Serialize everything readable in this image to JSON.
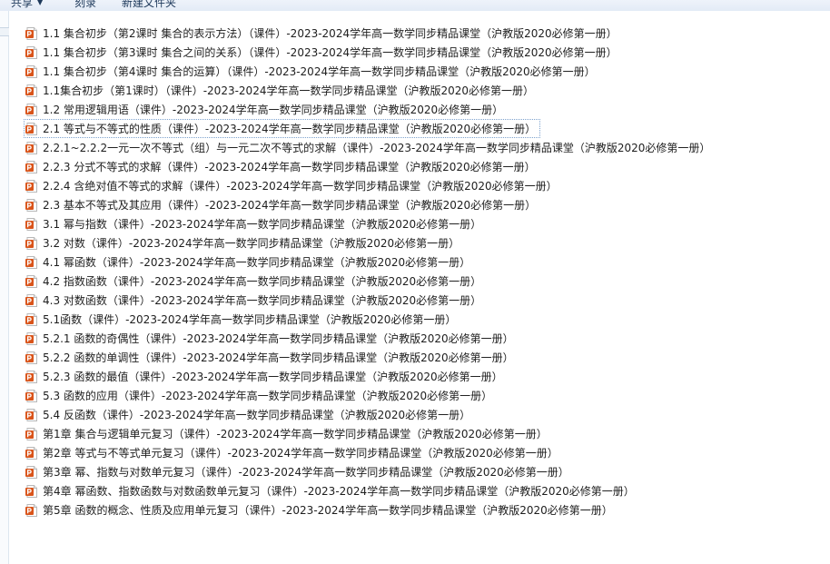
{
  "toolbar": {
    "share_label": "共享",
    "burn_label": "刻录",
    "new_folder_label": "新建文件夹"
  },
  "colors": {
    "icon_orange": "#d9541a",
    "toolbar_bg": "#e3ebf6",
    "focus_border": "#7da2ce"
  },
  "files": [
    {
      "icon": "ppt-file-icon",
      "name": "1.1 集合初步（第2课时 集合的表示方法）（课件）-2023-2024学年高一数学同步精品课堂（沪教版2020必修第一册）"
    },
    {
      "icon": "ppt-file-icon",
      "name": "1.1 集合初步（第3课时 集合之间的关系）（课件）-2023-2024学年高一数学同步精品课堂（沪教版2020必修第一册）"
    },
    {
      "icon": "ppt-file-icon",
      "name": "1.1 集合初步（第4课时 集合的运算）（课件）-2023-2024学年高一数学同步精品课堂（沪教版2020必修第一册）"
    },
    {
      "icon": "ppt-file-icon",
      "name": "1.1集合初步（第1课时）（课件）-2023-2024学年高一数学同步精品课堂（沪教版2020必修第一册）"
    },
    {
      "icon": "ppt-file-icon",
      "name": "1.2 常用逻辑用语（课件）-2023-2024学年高一数学同步精品课堂（沪教版2020必修第一册）"
    },
    {
      "icon": "ppt-file-icon",
      "name": "2.1 等式与不等式的性质（课件）-2023-2024学年高一数学同步精品课堂（沪教版2020必修第一册）"
    },
    {
      "icon": "ppt-file-icon",
      "name": "2.2.1~2.2.2一元一次不等式（组）与一元二次不等式的求解（课件）-2023-2024学年高一数学同步精品课堂（沪教版2020必修第一册）"
    },
    {
      "icon": "ppt-file-icon",
      "name": "2.2.3 分式不等式的求解（课件）-2023-2024学年高一数学同步精品课堂（沪教版2020必修第一册）"
    },
    {
      "icon": "ppt-file-icon",
      "name": "2.2.4 含绝对值不等式的求解（课件）-2023-2024学年高一数学同步精品课堂（沪教版2020必修第一册）"
    },
    {
      "icon": "ppt-file-icon",
      "name": "2.3 基本不等式及其应用（课件）-2023-2024学年高一数学同步精品课堂（沪教版2020必修第一册）"
    },
    {
      "icon": "ppt-file-icon",
      "name": "3.1 幂与指数（课件）-2023-2024学年高一数学同步精品课堂（沪教版2020必修第一册）"
    },
    {
      "icon": "ppt-file-icon",
      "name": "3.2 对数（课件）-2023-2024学年高一数学同步精品课堂（沪教版2020必修第一册）"
    },
    {
      "icon": "ppt-file-icon",
      "name": "4.1 幂函数（课件）-2023-2024学年高一数学同步精品课堂（沪教版2020必修第一册）"
    },
    {
      "icon": "ppt-file-icon",
      "name": "4.2 指数函数（课件）-2023-2024学年高一数学同步精品课堂（沪教版2020必修第一册）"
    },
    {
      "icon": "ppt-file-icon",
      "name": "4.3 对数函数（课件）-2023-2024学年高一数学同步精品课堂（沪教版2020必修第一册）"
    },
    {
      "icon": "ppt-file-icon",
      "name": "5.1函数（课件）-2023-2024学年高一数学同步精品课堂（沪教版2020必修第一册）"
    },
    {
      "icon": "ppt-file-icon",
      "name": "5.2.1 函数的奇偶性（课件）-2023-2024学年高一数学同步精品课堂（沪教版2020必修第一册）"
    },
    {
      "icon": "ppt-file-icon",
      "name": "5.2.2 函数的单调性（课件）-2023-2024学年高一数学同步精品课堂（沪教版2020必修第一册）"
    },
    {
      "icon": "ppt-file-icon",
      "name": "5.2.3 函数的最值（课件）-2023-2024学年高一数学同步精品课堂（沪教版2020必修第一册）"
    },
    {
      "icon": "ppt-file-icon",
      "name": "5.3 函数的应用（课件）-2023-2024学年高一数学同步精品课堂（沪教版2020必修第一册）"
    },
    {
      "icon": "ppt-file-icon",
      "name": "5.4 反函数（课件）-2023-2024学年高一数学同步精品课堂（沪教版2020必修第一册）"
    },
    {
      "icon": "ppt-file-icon",
      "name": "第1章 集合与逻辑单元复习（课件）-2023-2024学年高一数学同步精品课堂（沪教版2020必修第一册）"
    },
    {
      "icon": "ppt-file-icon",
      "name": "第2章 等式与不等式单元复习（课件）-2023-2024学年高一数学同步精品课堂（沪教版2020必修第一册）"
    },
    {
      "icon": "ppt-file-icon",
      "name": "第3章 幂、指数与对数单元复习（课件）-2023-2024学年高一数学同步精品课堂（沪教版2020必修第一册）"
    },
    {
      "icon": "ppt-file-icon",
      "name": "第4章 幂函数、指数函数与对数函数单元复习（课件）-2023-2024学年高一数学同步精品课堂（沪教版2020必修第一册）"
    },
    {
      "icon": "ppt-file-icon",
      "name": "第5章 函数的概念、性质及应用单元复习（课件）-2023-2024学年高一数学同步精品课堂（沪教版2020必修第一册）"
    }
  ],
  "focused_index": 5
}
